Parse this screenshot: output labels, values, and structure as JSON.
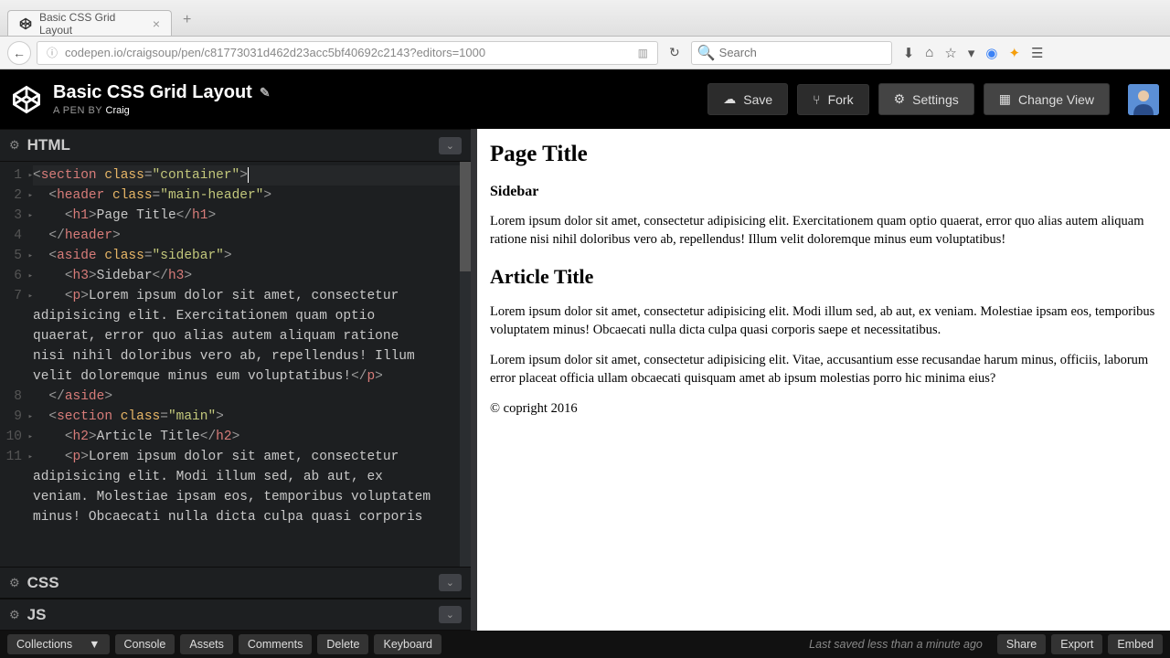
{
  "browser": {
    "tab_title": "Basic CSS Grid Layout",
    "url": "codepen.io/craigsoup/pen/c81773031d462d23acc5bf40692c2143?editors=1000",
    "search_placeholder": "Search"
  },
  "codepen": {
    "title": "Basic CSS Grid Layout",
    "byline_prefix": "A PEN BY ",
    "author": "Craig",
    "buttons": {
      "save": "Save",
      "fork": "Fork",
      "settings": "Settings",
      "change_view": "Change View"
    }
  },
  "panels": {
    "html": "HTML",
    "css": "CSS",
    "js": "JS"
  },
  "code_lines": [
    {
      "n": "1",
      "fold": true,
      "seg": [
        [
          "brk",
          "<"
        ],
        [
          "tag",
          "section"
        ],
        [
          "text",
          " "
        ],
        [
          "attr",
          "class"
        ],
        [
          "brk",
          "="
        ],
        [
          "str",
          "\"container\""
        ],
        [
          "brk",
          ">"
        ]
      ],
      "hl": true,
      "cursor": true
    },
    {
      "n": "2",
      "fold": true,
      "seg": [
        [
          "text",
          "  "
        ],
        [
          "brk",
          "<"
        ],
        [
          "tag",
          "header"
        ],
        [
          "text",
          " "
        ],
        [
          "attr",
          "class"
        ],
        [
          "brk",
          "="
        ],
        [
          "str",
          "\"main-header\""
        ],
        [
          "brk",
          ">"
        ]
      ]
    },
    {
      "n": "3",
      "fold": true,
      "seg": [
        [
          "text",
          "    "
        ],
        [
          "brk",
          "<"
        ],
        [
          "tag",
          "h1"
        ],
        [
          "brk",
          ">"
        ],
        [
          "text",
          "Page Title"
        ],
        [
          "brk",
          "</"
        ],
        [
          "tag",
          "h1"
        ],
        [
          "brk",
          ">"
        ]
      ]
    },
    {
      "n": "4",
      "seg": [
        [
          "text",
          "  "
        ],
        [
          "brk",
          "</"
        ],
        [
          "tag",
          "header"
        ],
        [
          "brk",
          ">"
        ]
      ]
    },
    {
      "n": "5",
      "fold": true,
      "seg": [
        [
          "text",
          "  "
        ],
        [
          "brk",
          "<"
        ],
        [
          "tag",
          "aside"
        ],
        [
          "text",
          " "
        ],
        [
          "attr",
          "class"
        ],
        [
          "brk",
          "="
        ],
        [
          "str",
          "\"sidebar\""
        ],
        [
          "brk",
          ">"
        ]
      ]
    },
    {
      "n": "6",
      "fold": true,
      "seg": [
        [
          "text",
          "    "
        ],
        [
          "brk",
          "<"
        ],
        [
          "tag",
          "h3"
        ],
        [
          "brk",
          ">"
        ],
        [
          "text",
          "Sidebar"
        ],
        [
          "brk",
          "</"
        ],
        [
          "tag",
          "h3"
        ],
        [
          "brk",
          ">"
        ]
      ]
    },
    {
      "n": "7",
      "fold": true,
      "seg": [
        [
          "text",
          "    "
        ],
        [
          "brk",
          "<"
        ],
        [
          "tag",
          "p"
        ],
        [
          "brk",
          ">"
        ],
        [
          "text",
          "Lorem ipsum dolor sit amet, consectetur"
        ]
      ]
    },
    {
      "n": "",
      "seg": [
        [
          "text",
          "adipisicing elit. Exercitationem quam optio"
        ]
      ]
    },
    {
      "n": "",
      "seg": [
        [
          "text",
          "quaerat, error quo alias autem aliquam ratione"
        ]
      ]
    },
    {
      "n": "",
      "seg": [
        [
          "text",
          "nisi nihil doloribus vero ab, repellendus! Illum"
        ]
      ]
    },
    {
      "n": "",
      "seg": [
        [
          "text",
          "velit doloremque minus eum voluptatibus!"
        ],
        [
          "brk",
          "</"
        ],
        [
          "tag",
          "p"
        ],
        [
          "brk",
          ">"
        ]
      ]
    },
    {
      "n": "8",
      "seg": [
        [
          "text",
          "  "
        ],
        [
          "brk",
          "</"
        ],
        [
          "tag",
          "aside"
        ],
        [
          "brk",
          ">"
        ]
      ]
    },
    {
      "n": "9",
      "fold": true,
      "seg": [
        [
          "text",
          "  "
        ],
        [
          "brk",
          "<"
        ],
        [
          "tag",
          "section"
        ],
        [
          "text",
          " "
        ],
        [
          "attr",
          "class"
        ],
        [
          "brk",
          "="
        ],
        [
          "str",
          "\"main\""
        ],
        [
          "brk",
          ">"
        ]
      ]
    },
    {
      "n": "10",
      "fold": true,
      "seg": [
        [
          "text",
          "    "
        ],
        [
          "brk",
          "<"
        ],
        [
          "tag",
          "h2"
        ],
        [
          "brk",
          ">"
        ],
        [
          "text",
          "Article Title"
        ],
        [
          "brk",
          "</"
        ],
        [
          "tag",
          "h2"
        ],
        [
          "brk",
          ">"
        ]
      ]
    },
    {
      "n": "11",
      "fold": true,
      "seg": [
        [
          "text",
          "    "
        ],
        [
          "brk",
          "<"
        ],
        [
          "tag",
          "p"
        ],
        [
          "brk",
          ">"
        ],
        [
          "text",
          "Lorem ipsum dolor sit amet, consectetur"
        ]
      ]
    },
    {
      "n": "",
      "seg": [
        [
          "text",
          "adipisicing elit. Modi illum sed, ab aut, ex"
        ]
      ]
    },
    {
      "n": "",
      "seg": [
        [
          "text",
          "veniam. Molestiae ipsam eos, temporibus voluptatem"
        ]
      ]
    },
    {
      "n": "",
      "seg": [
        [
          "text",
          "minus! Obcaecati nulla dicta culpa quasi corporis"
        ]
      ]
    }
  ],
  "preview": {
    "h1": "Page Title",
    "h3": "Sidebar",
    "p1": "Lorem ipsum dolor sit amet, consectetur adipisicing elit. Exercitationem quam optio quaerat, error quo alias autem aliquam ratione nisi nihil doloribus vero ab, repellendus! Illum velit doloremque minus eum voluptatibus!",
    "h2": "Article Title",
    "p2": "Lorem ipsum dolor sit amet, consectetur adipisicing elit. Modi illum sed, ab aut, ex veniam. Molestiae ipsam eos, temporibus voluptatem minus! Obcaecati nulla dicta culpa quasi corporis saepe et necessitatibus.",
    "p3": "Lorem ipsum dolor sit amet, consectetur adipisicing elit. Vitae, accusantium esse recusandae harum minus, officiis, laborum error placeat officia ullam obcaecati quisquam amet ab ipsum molestias porro hic minima eius?",
    "footer": "© copright 2016"
  },
  "bottom": {
    "collections": "Collections",
    "console": "Console",
    "assets": "Assets",
    "comments": "Comments",
    "delete": "Delete",
    "keyboard": "Keyboard",
    "status": "Last saved less than a minute ago",
    "share": "Share",
    "export": "Export",
    "embed": "Embed"
  }
}
